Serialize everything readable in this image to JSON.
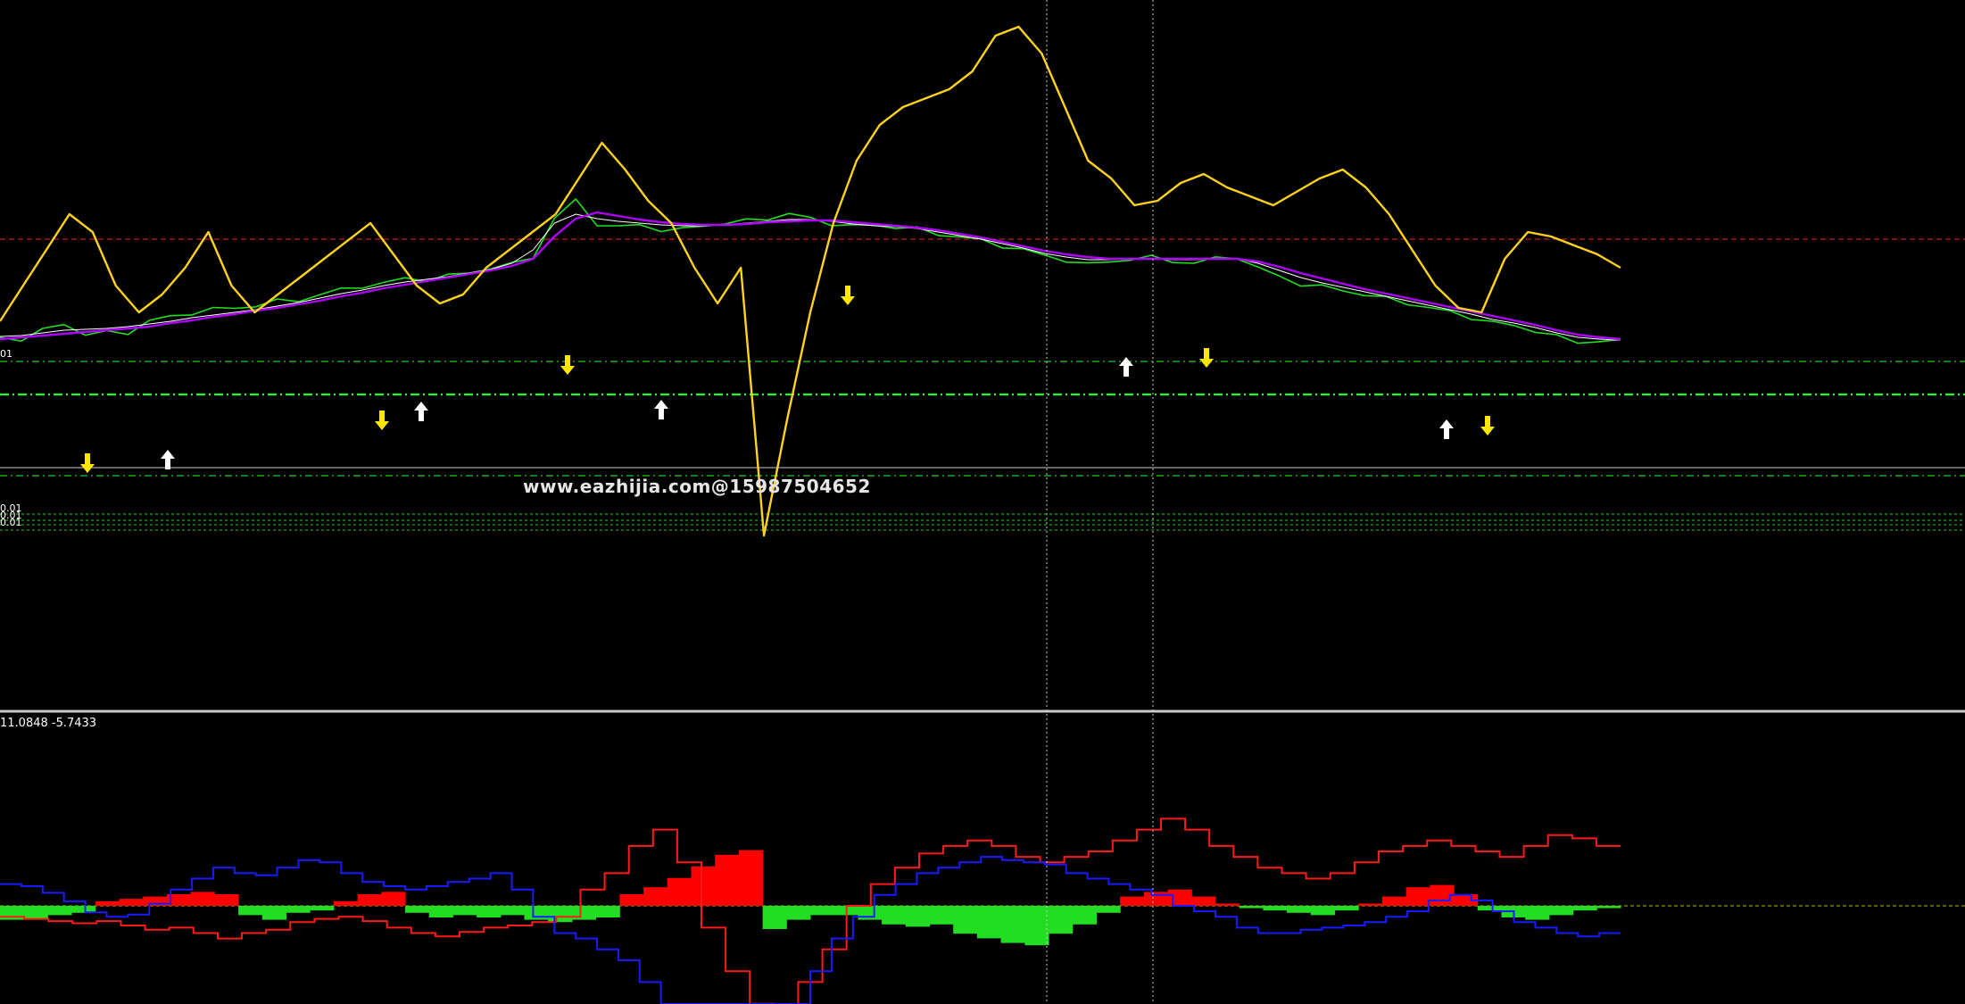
{
  "colors": {
    "background": "#000000",
    "price": "#22dd22",
    "ma_fast": "#ffffff",
    "ma_slow": "#b000ff",
    "oscillator": "#ffd21e",
    "sell_arrow": "#ffe600",
    "buy_arrow": "#ffffff",
    "hist_pos": "#ff0000",
    "hist_neg": "#22dd22",
    "line_red": "#ff1a1a",
    "line_blue": "#1a1aff",
    "zero_line": "#b8b800"
  },
  "main_panel": {
    "top_label": "",
    "level_label_upper": "01",
    "level_labels_lower": [
      "0.01",
      "0.01",
      "0.01"
    ],
    "watermark": "www.eazhijia.com@15987504652"
  },
  "sub_panel": {
    "label": "11.0848 -5.7433"
  },
  "chart_data": [
    {
      "type": "line",
      "panel": "main",
      "series": [
        {
          "role": "price",
          "values": [
            378,
            380,
            371,
            362,
            375,
            373,
            372,
            360,
            355,
            350,
            347,
            345,
            342,
            338,
            336,
            330,
            325,
            320,
            318,
            312,
            313,
            310,
            305,
            300,
            297,
            287,
            245,
            225,
            250,
            255,
            252,
            257,
            258,
            252,
            250,
            248,
            244,
            240,
            245,
            250,
            254,
            252,
            254,
            257,
            262,
            265,
            270,
            275,
            280,
            287,
            291,
            297,
            293,
            290,
            289,
            292,
            295,
            290,
            287,
            301,
            310,
            318,
            322,
            325,
            330,
            335,
            339,
            345,
            350,
            355,
            362,
            365,
            370,
            378,
            383,
            382,
            383
          ]
        },
        {
          "role": "ma_fast",
          "values": [
            377,
            376,
            373,
            370,
            369,
            368,
            366,
            363,
            360,
            356,
            353,
            350,
            347,
            343,
            339,
            334,
            329,
            325,
            320,
            316,
            313,
            310,
            306,
            302,
            295,
            280,
            250,
            240,
            245,
            248,
            250,
            252,
            253,
            253,
            252,
            250,
            248,
            246,
            246,
            248,
            251,
            253,
            254,
            256,
            260,
            264,
            268,
            273,
            278,
            284,
            288,
            291,
            291,
            290,
            290,
            291,
            291,
            290,
            290,
            295,
            303,
            311,
            317,
            322,
            327,
            332,
            337,
            342,
            347,
            352,
            358,
            362,
            367,
            373,
            378,
            380,
            381
          ]
        },
        {
          "role": "ma_slow",
          "values": [
            380,
            378,
            376,
            374,
            372,
            370,
            368,
            366,
            362,
            359,
            355,
            352,
            348,
            345,
            341,
            337,
            332,
            328,
            323,
            319,
            315,
            311,
            307,
            303,
            298,
            290,
            265,
            245,
            238,
            242,
            246,
            249,
            251,
            252,
            252,
            251,
            249,
            248,
            247,
            247,
            249,
            251,
            253,
            255,
            258,
            262,
            266,
            271,
            276,
            281,
            285,
            288,
            290,
            290,
            290,
            290,
            290,
            290,
            290,
            293,
            299,
            306,
            312,
            318,
            324,
            329,
            334,
            339,
            344,
            349,
            354,
            359,
            364,
            370,
            375,
            378,
            380
          ]
        },
        {
          "role": "oscillator",
          "values": [
            360,
            320,
            280,
            240,
            260,
            320,
            350,
            330,
            300,
            260,
            320,
            350,
            330,
            310,
            290,
            270,
            250,
            285,
            320,
            340,
            330,
            300,
            280,
            260,
            240,
            200,
            160,
            190,
            225,
            250,
            300,
            340,
            300,
            600,
            470,
            350,
            250,
            180,
            140,
            120,
            110,
            100,
            80,
            40,
            30,
            60,
            120,
            180,
            200,
            230,
            225,
            205,
            195,
            210,
            220,
            230,
            215,
            200,
            190,
            210,
            240,
            280,
            320,
            345,
            350,
            290,
            260,
            265,
            275,
            285,
            300
          ]
        }
      ]
    },
    {
      "type": "bar",
      "panel": "sub",
      "series": [
        {
          "role": "histogram",
          "values": [
            -6,
            -6,
            -4,
            -3,
            2,
            3,
            4,
            5,
            6,
            5,
            -4,
            -6,
            -3,
            -2,
            2,
            5,
            6,
            -3,
            -5,
            -4,
            -5,
            -4,
            -6,
            -7,
            -6,
            -5,
            5,
            8,
            12,
            17,
            22,
            24,
            -10,
            -6,
            -4,
            -4,
            -6,
            -8,
            -9,
            -8,
            -12,
            -14,
            -16,
            -17,
            -12,
            -8,
            -3,
            4,
            6,
            7,
            4,
            1,
            -1,
            -2,
            -3,
            -4,
            -2,
            1,
            4,
            8,
            9,
            5,
            -2,
            -5,
            -6,
            -4,
            -2,
            -1
          ]
        },
        {
          "role": "line_red",
          "values": [
            -10,
            -12,
            -14,
            -16,
            -14,
            -18,
            -22,
            -20,
            -25,
            -30,
            -25,
            -22,
            -15,
            -12,
            -10,
            -14,
            -20,
            -25,
            -28,
            -24,
            -20,
            -18,
            -15,
            -10,
            15,
            30,
            55,
            70,
            40,
            -20,
            -60,
            -90,
            -110,
            -70,
            -40,
            0,
            20,
            35,
            48,
            55,
            60,
            55,
            45,
            40,
            45,
            50,
            60,
            70,
            80,
            70,
            55,
            45,
            35,
            30,
            25,
            30,
            40,
            50,
            55,
            60,
            55,
            50,
            45,
            55,
            65,
            62,
            55
          ]
        },
        {
          "role": "line_blue",
          "values": [
            20,
            18,
            12,
            4,
            -6,
            -10,
            -8,
            2,
            15,
            25,
            35,
            30,
            28,
            35,
            42,
            40,
            30,
            22,
            18,
            15,
            18,
            22,
            25,
            30,
            15,
            -10,
            -25,
            -30,
            -40,
            -50,
            -70,
            -100,
            -140,
            -170,
            -190,
            -180,
            -160,
            -120,
            -60,
            -30,
            -10,
            10,
            20,
            30,
            35,
            40,
            45,
            42,
            40,
            38,
            30,
            25,
            20,
            15,
            10,
            0,
            -5,
            -10,
            -20,
            -25,
            -25,
            -22,
            -20,
            -18,
            -15,
            -10,
            -5,
            5,
            10,
            5,
            -5,
            -15,
            -20,
            -25,
            -28,
            -25
          ]
        }
      ]
    }
  ]
}
